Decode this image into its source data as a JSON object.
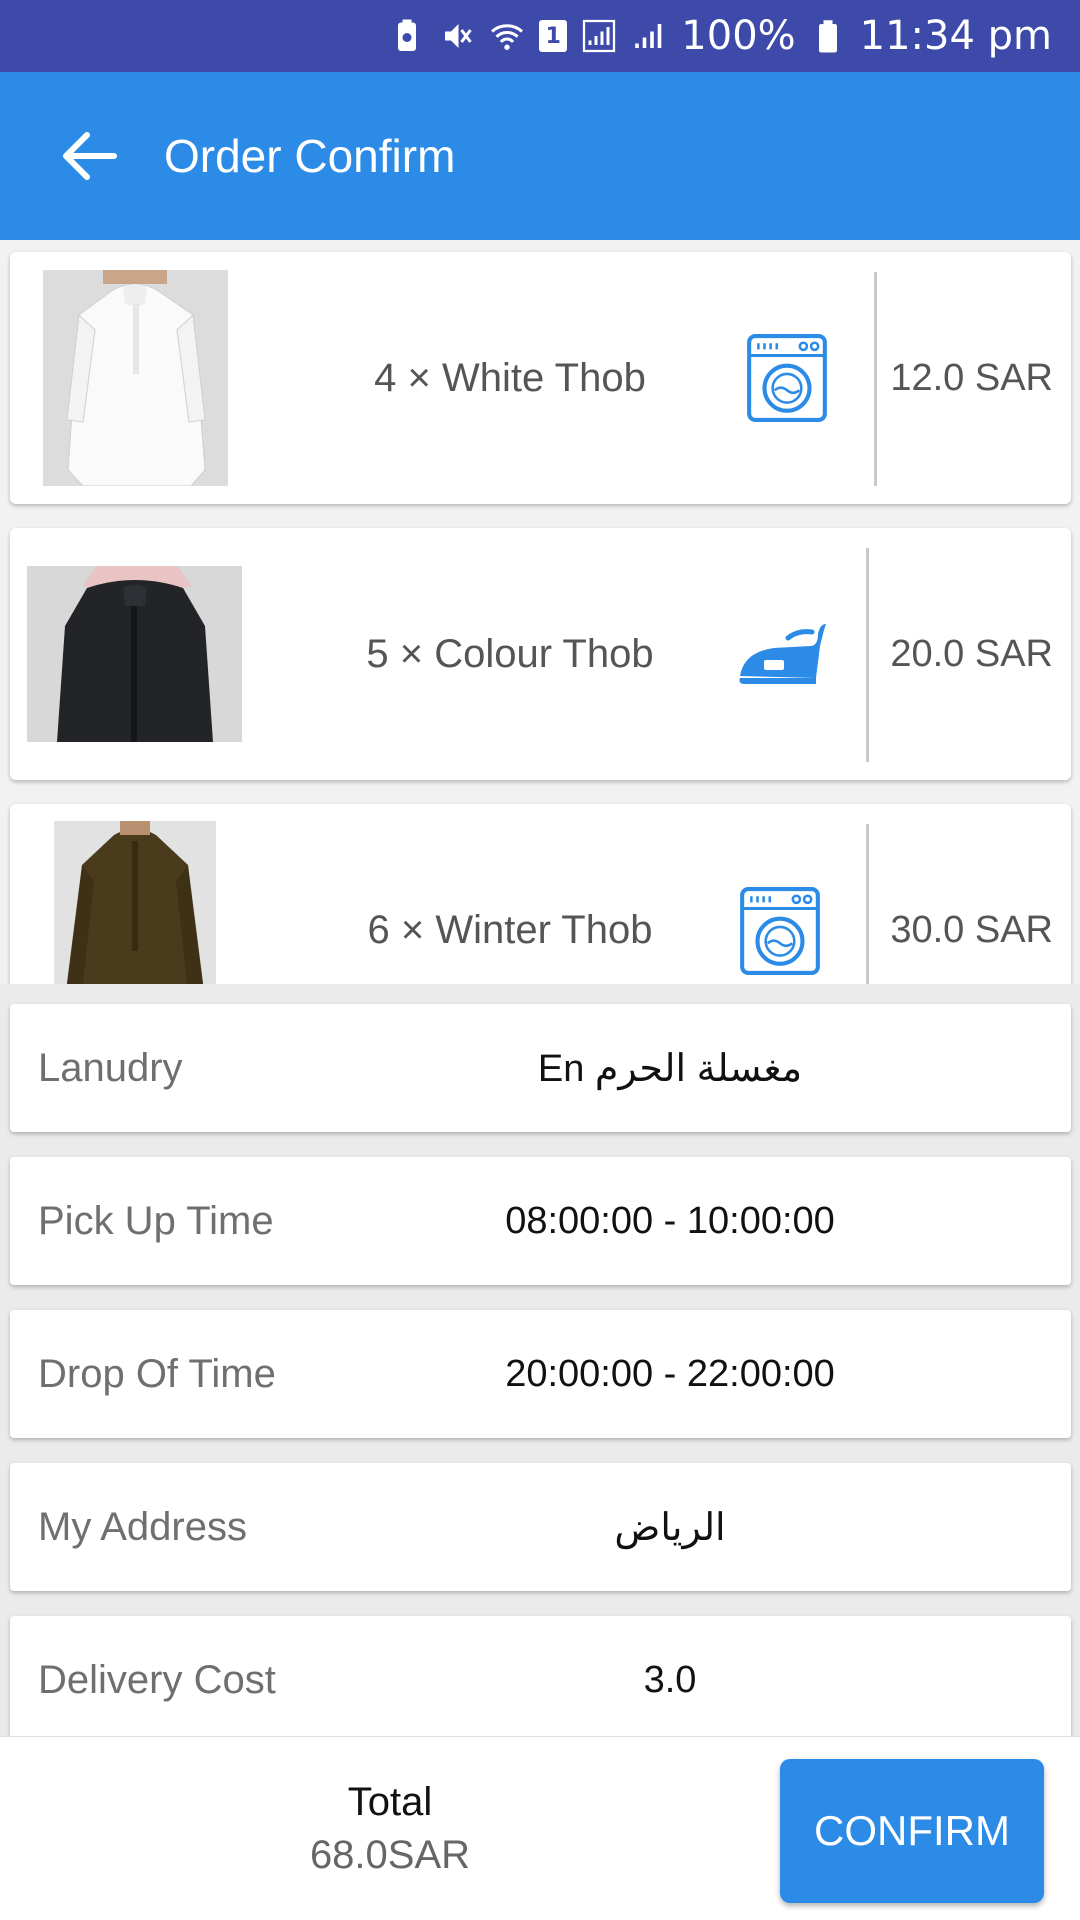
{
  "status_bar": {
    "sim_slot": "1",
    "battery_percent": "100%",
    "time": "11:34 pm"
  },
  "app_bar": {
    "title": "Order Confirm"
  },
  "order_items": [
    {
      "name": "4 × White Thob",
      "price": "12.0 SAR",
      "service_icon": "washing-machine-icon",
      "image": "white-thob-image"
    },
    {
      "name": "5 × Colour Thob",
      "price": "20.0 SAR",
      "service_icon": "iron-icon",
      "image": "colour-thob-image"
    },
    {
      "name": "6 × Winter Thob",
      "price": "30.0 SAR",
      "service_icon": "washing-machine-icon",
      "image": "winter-thob-image"
    }
  ],
  "details": {
    "laundry": {
      "label": "Lanudry",
      "value": "En مغسلة الحرم"
    },
    "pickup": {
      "label": "Pick Up Time",
      "value": "08:00:00 - 10:00:00"
    },
    "dropoff": {
      "label": "Drop Of Time",
      "value": "20:00:00 - 22:00:00"
    },
    "address": {
      "label": "My Address",
      "value": "الرياض"
    },
    "delivery": {
      "label": "Delivery Cost",
      "value": "3.0"
    }
  },
  "footer": {
    "total_label": "Total",
    "total_value": "68.0SAR",
    "confirm_label": "CONFIRM"
  },
  "colors": {
    "status_bar": "#3e4aa9",
    "app_bar": "#2c8be6",
    "accent": "#2c8be6"
  }
}
